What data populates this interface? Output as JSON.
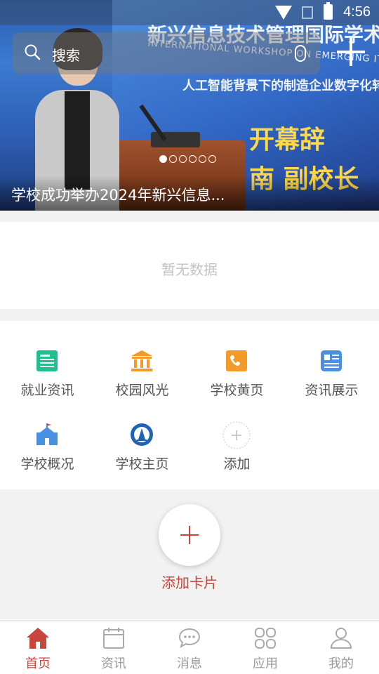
{
  "status_bar": {
    "time": "4:56"
  },
  "search": {
    "label": "搜索"
  },
  "banner": {
    "caption": "学校成功举办2024年新兴信息...",
    "sign_title": "新兴信息技术管理国际学术研讨会",
    "sign_subtitle": "INTERNATIONAL WORKSHOP ON EMERGING IT MANAGEMENT",
    "sign_theme": "人工智能背景下的制造企业数字化转型",
    "sign_big_1": "开幕辞",
    "sign_big_2": "南 副校长",
    "slide_count": 6,
    "active_slide": 1
  },
  "empty_section": {
    "text": "暂无数据"
  },
  "apps": [
    {
      "label": "就业资讯",
      "icon": "news-doc-icon",
      "color": "#1fbf8f"
    },
    {
      "label": "校园风光",
      "icon": "building-icon",
      "color": "#f39a2b"
    },
    {
      "label": "学校黄页",
      "icon": "phone-book-icon",
      "color": "#f39a2b"
    },
    {
      "label": "资讯展示",
      "icon": "news-card-icon",
      "color": "#4a90e2"
    },
    {
      "label": "学校概况",
      "icon": "school-icon",
      "color": "#4a90e2"
    },
    {
      "label": "学校主页",
      "icon": "school-logo-icon",
      "color": "#1f63b5"
    },
    {
      "label": "添加",
      "icon": "add-icon",
      "color": "#bbbbbb"
    }
  ],
  "add_card": {
    "label": "添加卡片"
  },
  "tabs": [
    {
      "label": "首页",
      "icon": "home-icon",
      "active": true
    },
    {
      "label": "资讯",
      "icon": "calendar-icon",
      "active": false
    },
    {
      "label": "消息",
      "icon": "chat-icon",
      "active": false
    },
    {
      "label": "应用",
      "icon": "apps-icon",
      "active": false
    },
    {
      "label": "我的",
      "icon": "user-icon",
      "active": false
    }
  ],
  "colors": {
    "accent": "#c9463d",
    "muted": "#999999"
  }
}
